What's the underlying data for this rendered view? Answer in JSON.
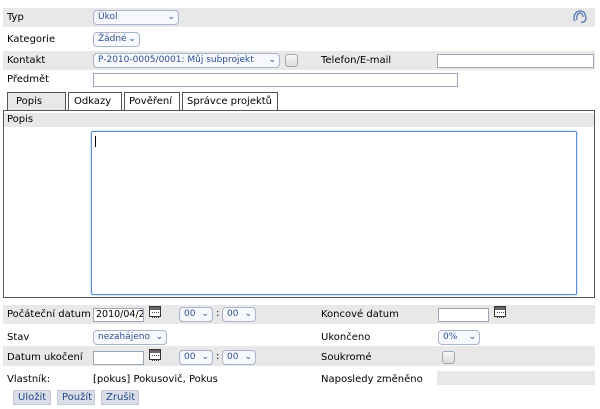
{
  "form": {
    "typ_label": "Typ",
    "typ_value": "Úkol",
    "kategorie_label": "Kategorie",
    "kategorie_value": "Žádné",
    "kontakt_label": "Kontakt",
    "kontakt_value": "P-2010-0005/0001: Můj subprojekt",
    "telefon_label": "Telefon/E-mail",
    "telefon_value": "",
    "predmet_label": "Předmět",
    "predmet_value": ""
  },
  "tabs": [
    {
      "label": "Popis",
      "active": true
    },
    {
      "label": "Odkazy",
      "active": false
    },
    {
      "label": "Pověření",
      "active": false
    },
    {
      "label": "Správce projektů",
      "active": false
    }
  ],
  "popis": {
    "section_label": "Popis",
    "text": ""
  },
  "dates": {
    "start_label": "Počáteční datum",
    "start_value": "2010/04/2",
    "start_hour": "00",
    "start_minute": "00",
    "end_label": "Koncové datum",
    "end_value": "",
    "stav_label": "Stav",
    "stav_value": "nezahájeno",
    "ukonceno_label": "Ukončeno",
    "ukonceno_value": "0%",
    "datum_ukonceni_label": "Datum ukočení",
    "datum_ukonceni_value": "",
    "uk_hour": "00",
    "uk_minute": "00",
    "soukrome_label": "Soukromé",
    "vlastnik_label": "Vlastník:",
    "vlastnik_value": "[pokus] Pokusovič, Pokus",
    "naposledy_label": "Naposledy změněno",
    "naposledy_value": ""
  },
  "buttons": {
    "save": "Uložit",
    "apply": "Použít",
    "cancel": "Zrušit"
  },
  "icons": {
    "corner": "paperclip-icon",
    "calendar": "calendar-icon"
  }
}
